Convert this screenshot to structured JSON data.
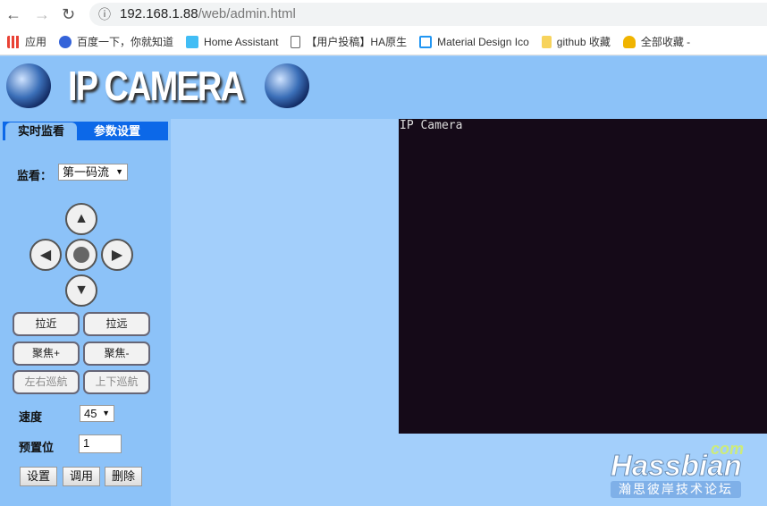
{
  "browser": {
    "url_host": "192.168.1.88",
    "url_path": "/web/admin.html",
    "bookmarks": [
      {
        "label": "应用",
        "icon": "apps-grid-icon",
        "color": "#e94235"
      },
      {
        "label": "百度一下，你就知道",
        "icon": "baidu-paw-icon",
        "color": "#3463d9"
      },
      {
        "label": "Home Assistant",
        "icon": "home-assistant-icon",
        "color": "#41bdf5"
      },
      {
        "label": "【用户投稿】HA原生",
        "icon": "page-icon",
        "color": "#ffffff"
      },
      {
        "label": "Material Design Ico",
        "icon": "material-design-icon",
        "color": "#2196f3"
      },
      {
        "label": "github 收藏",
        "icon": "folder-icon",
        "color": "#f7d35c"
      },
      {
        "label": "全部收藏 -",
        "icon": "trophy-icon",
        "color": "#f0b400"
      }
    ]
  },
  "header": {
    "title": "IP CAMERA"
  },
  "tabs": {
    "live": "实时监看",
    "settings": "参数设置"
  },
  "panel": {
    "monitor_label": "监看：",
    "stream": "第一码流",
    "zoom_in": "拉近",
    "zoom_out": "拉远",
    "focus_plus": "聚焦+",
    "focus_minus": "聚焦-",
    "pan_cruise": "左右巡航",
    "tilt_cruise": "上下巡航",
    "speed_label": "速度",
    "speed": "45",
    "preset_label": "预置位",
    "preset": "1",
    "set": "设置",
    "call": "调用",
    "delete": "删除"
  },
  "video": {
    "label": "IP Camera"
  },
  "watermark": {
    "brand": "Hassbian",
    "tld": "com",
    "subtitle": "瀚思彼岸技术论坛"
  }
}
